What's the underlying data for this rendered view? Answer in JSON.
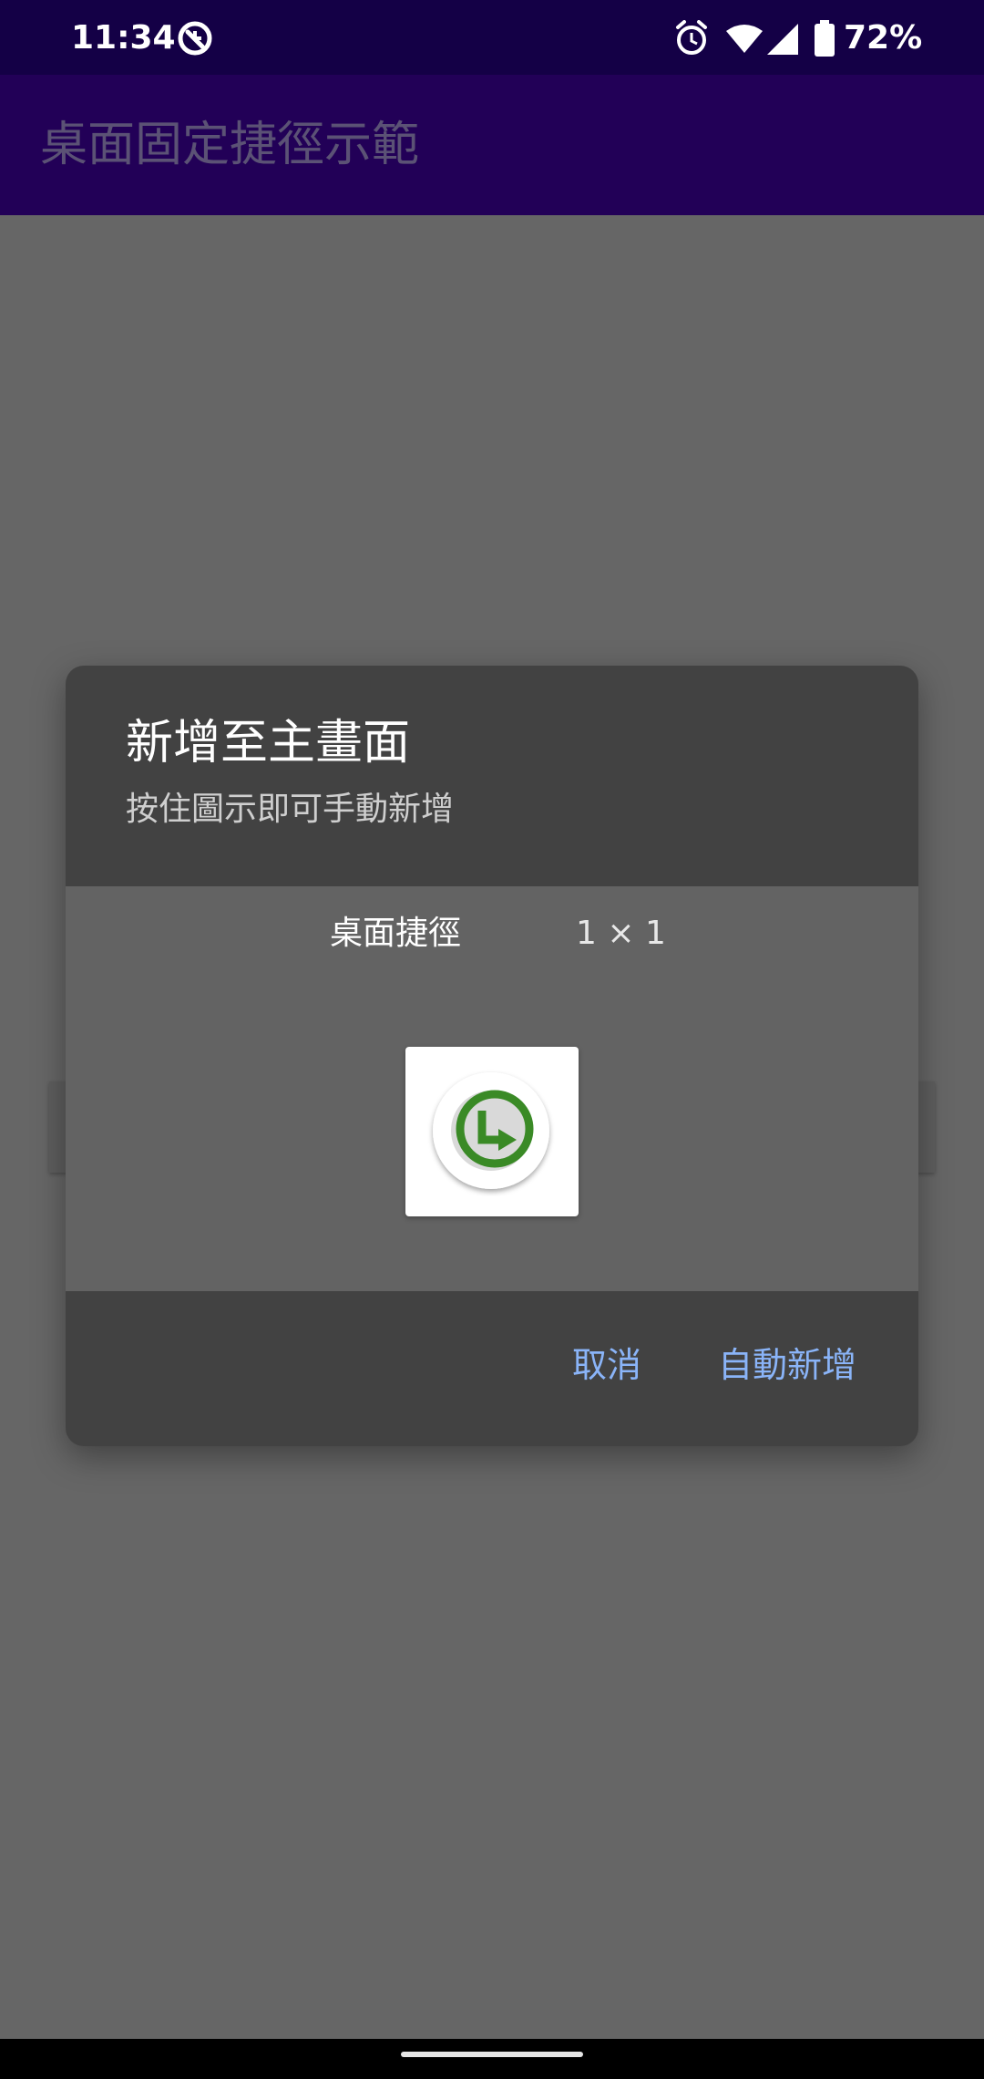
{
  "status_bar": {
    "time": "11:34",
    "battery_percent": "72%",
    "icons": [
      "app-notification-icon",
      "alarm-icon",
      "wifi-icon",
      "signal-icon",
      "battery-icon"
    ]
  },
  "app_bar": {
    "title": "桌面固定捷徑示範"
  },
  "dialog": {
    "title": "新增至主畫面",
    "subtitle": "按住圖示即可手動新增",
    "widget": {
      "label": "桌面捷徑",
      "size": "1 × 1",
      "icon": "shortcut-arrow-icon"
    },
    "actions": {
      "cancel_label": "取消",
      "add_label": "自動新增"
    }
  },
  "colors": {
    "status_bar": "#140046",
    "app_bar": "#220057",
    "scrim_background": "#666666",
    "dialog_background": "#424242",
    "widget_area": "#636363",
    "accent_button": "#8ab4f8",
    "icon_green": "#3a8a26"
  }
}
